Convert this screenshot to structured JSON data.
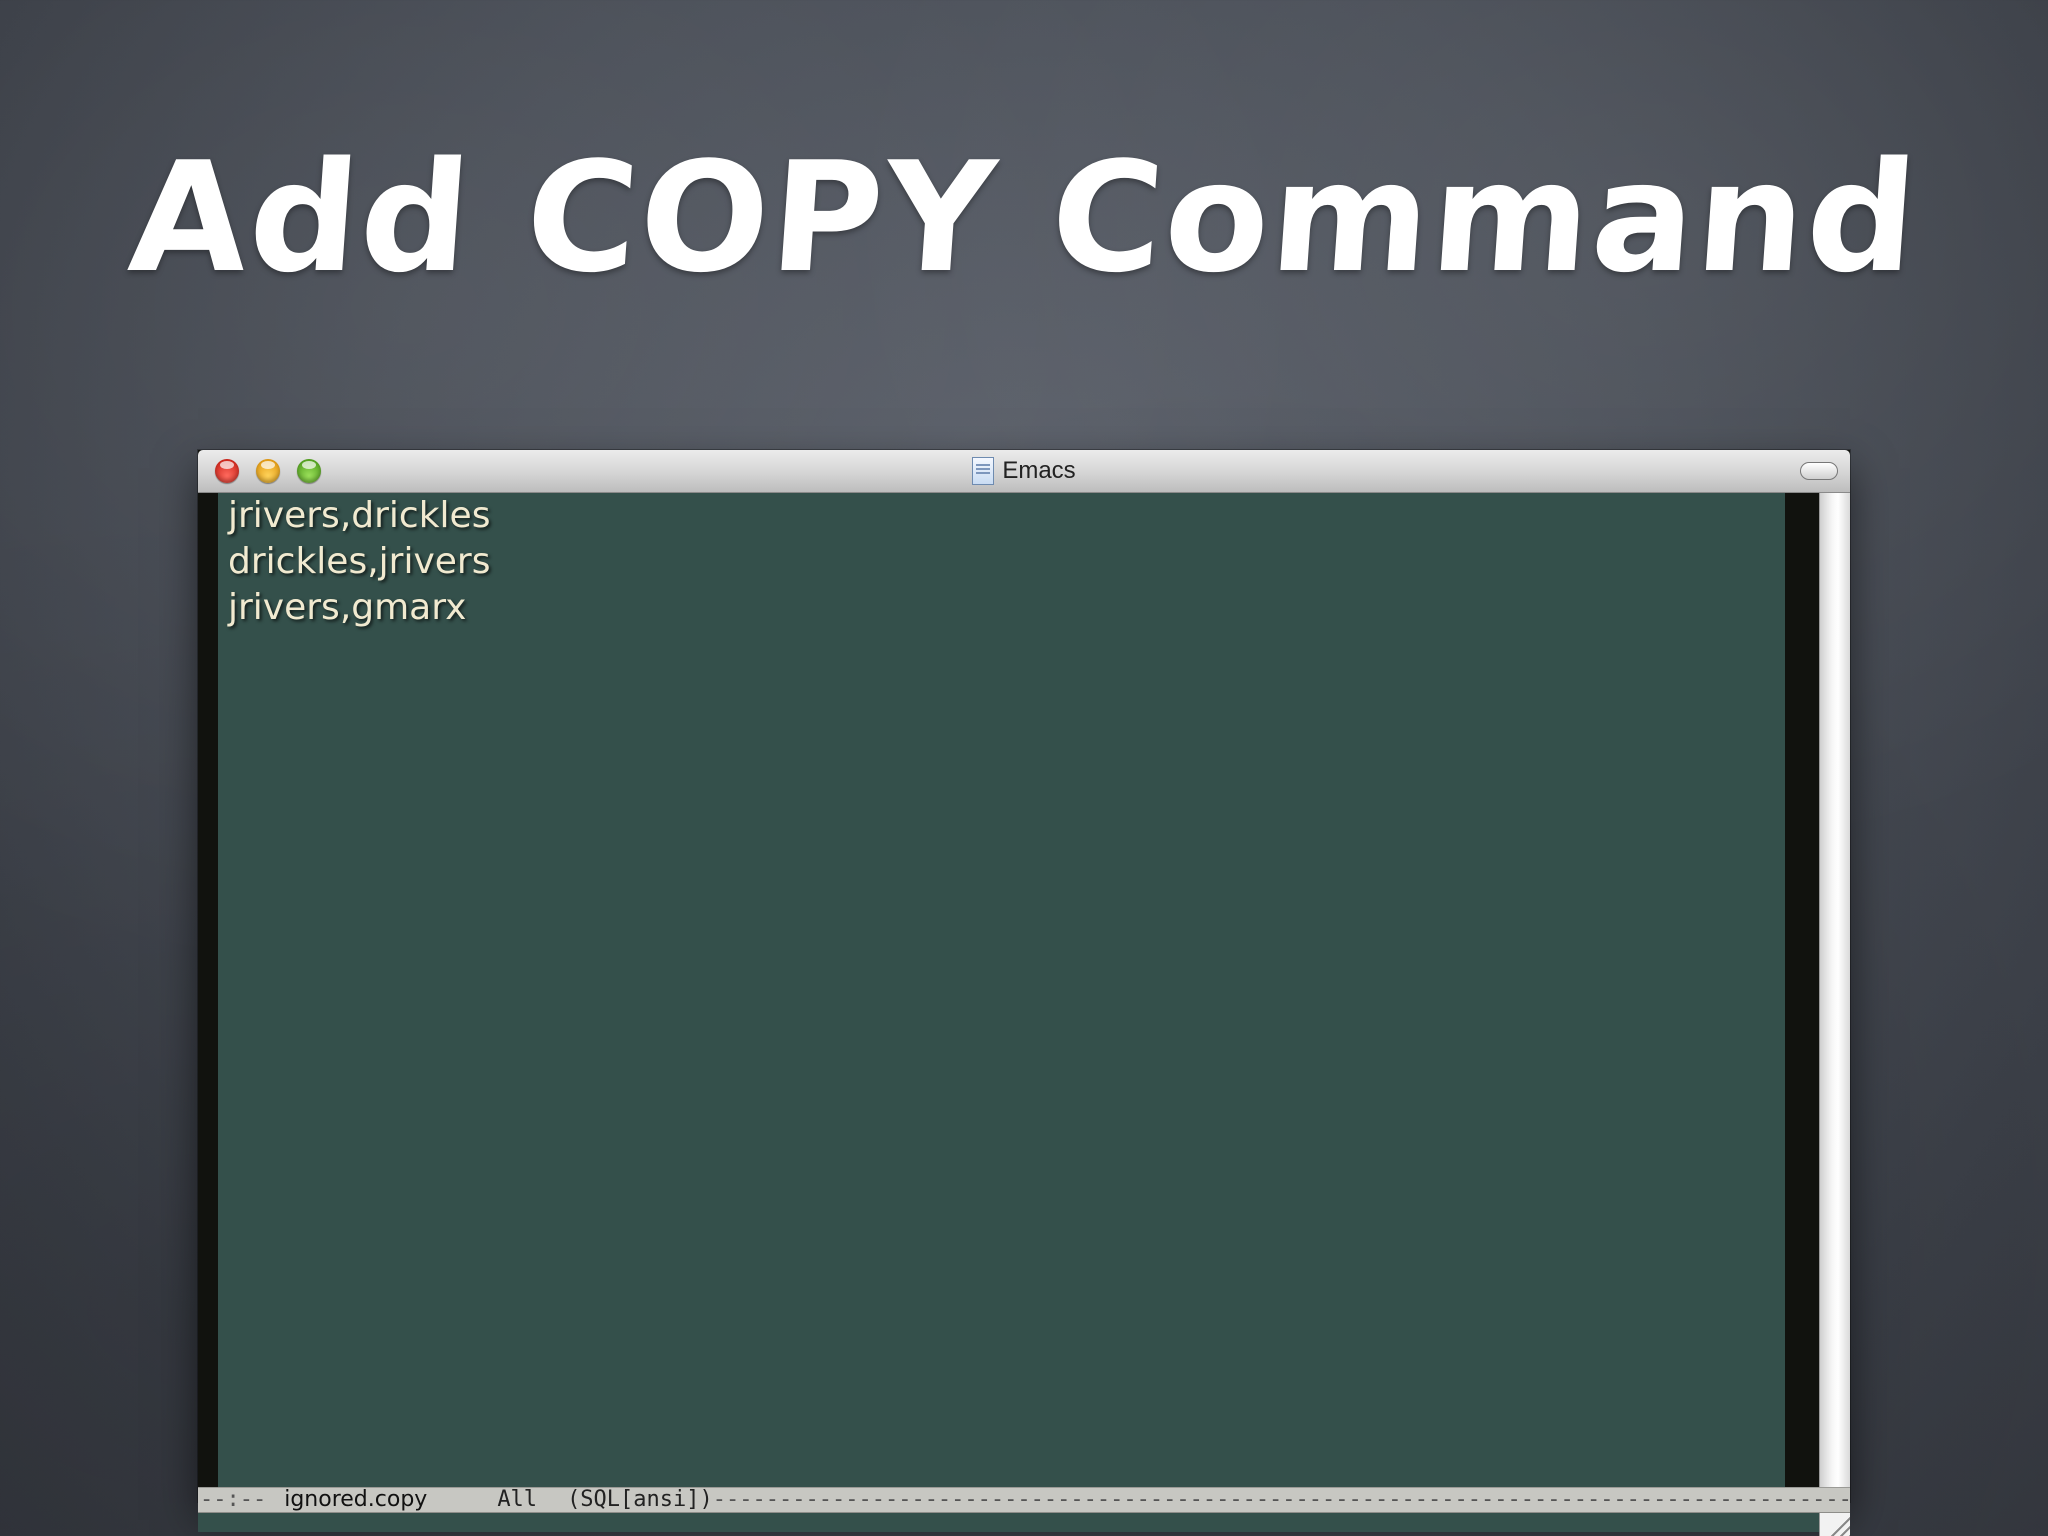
{
  "slide": {
    "title": "Add COPY Command"
  },
  "window": {
    "title": "Emacs",
    "controls": {
      "close": "close-button",
      "minimize": "minimize-button",
      "zoom": "zoom-button"
    }
  },
  "editor": {
    "lines": [
      "jrivers,drickles",
      "drickles,jrivers",
      "jrivers,gmarx"
    ]
  },
  "modeline": {
    "status": "--:--",
    "buffer_name": "ignored.copy",
    "position": "All",
    "mode": "(SQL[ansi])",
    "fill": "--------------------------------------------------------------------------------------------------------------------------------------------------------"
  },
  "colors": {
    "background": "#4a4f58",
    "editor_bg": "#34504b",
    "editor_fg": "#f1ead0",
    "title_fg": "#ffffff"
  }
}
